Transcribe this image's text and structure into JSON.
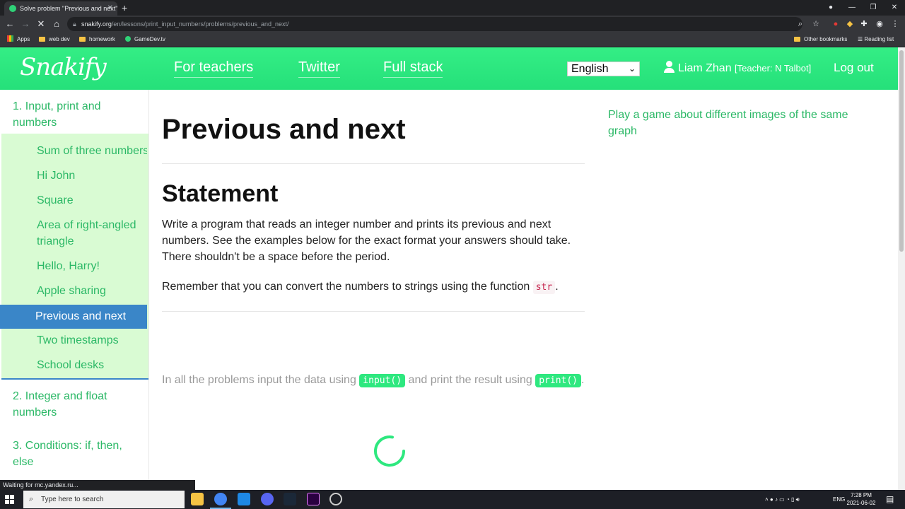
{
  "browser": {
    "tab_title": "Solve problem \"Previous and next\"",
    "tab_close": "✕",
    "new_tab": "+",
    "url_host": "snakify.org",
    "url_path": "/en/lessons/print_input_numbers/problems/previous_and_next/",
    "bookmarks": [
      "Apps",
      "web dev",
      "homework",
      "GameDev.tv"
    ],
    "other_bookmarks": "Other bookmarks",
    "reading_list": "Reading list",
    "status_text": "Waiting for mc.yandex.ru..."
  },
  "site": {
    "logo": "Snakify",
    "nav": [
      "For teachers",
      "Twitter",
      "Full stack"
    ],
    "language": "English",
    "user_name": "Liam Zhan",
    "teacher": "[Teacher: N Talbot]",
    "logout": "Log out"
  },
  "sidebar": {
    "section1": "1. Input, print and numbers",
    "items": [
      "Sum of three numbers",
      "Hi John",
      "Square",
      "Area of right-angled triangle",
      "Hello, Harry!",
      "Apple sharing",
      "Previous and next",
      "Two timestamps",
      "School desks"
    ],
    "active_index": 6,
    "section2": "2. Integer and float numbers",
    "section3": "3. Conditions: if, then, else"
  },
  "main": {
    "title": "Previous and next",
    "statement_heading": "Statement",
    "statement_text": "Write a program that reads an integer number and prints its previous and next numbers. See the examples below for the exact format your answers should take. There shouldn't be a space before the period.",
    "remember_text": "Remember that you can convert the numbers to strings using the function",
    "remember_code": "str",
    "remember_end": ".",
    "note_pre": "In all the problems input the data using",
    "note_input": "input()",
    "note_mid": "and print the result using",
    "note_print": "print()",
    "note_end": "."
  },
  "aside": {
    "game_link": "Play a game about different images of the same graph"
  },
  "taskbar": {
    "search_placeholder": "Type here to search",
    "lang": "ENG",
    "time": "7:28 PM",
    "date": "2021-06-02"
  },
  "colors": {
    "brand_green": "#2ee87f",
    "link_green": "#2bb866",
    "active_blue": "#3a86c8",
    "sidebar_bg": "#d9fbd3"
  }
}
